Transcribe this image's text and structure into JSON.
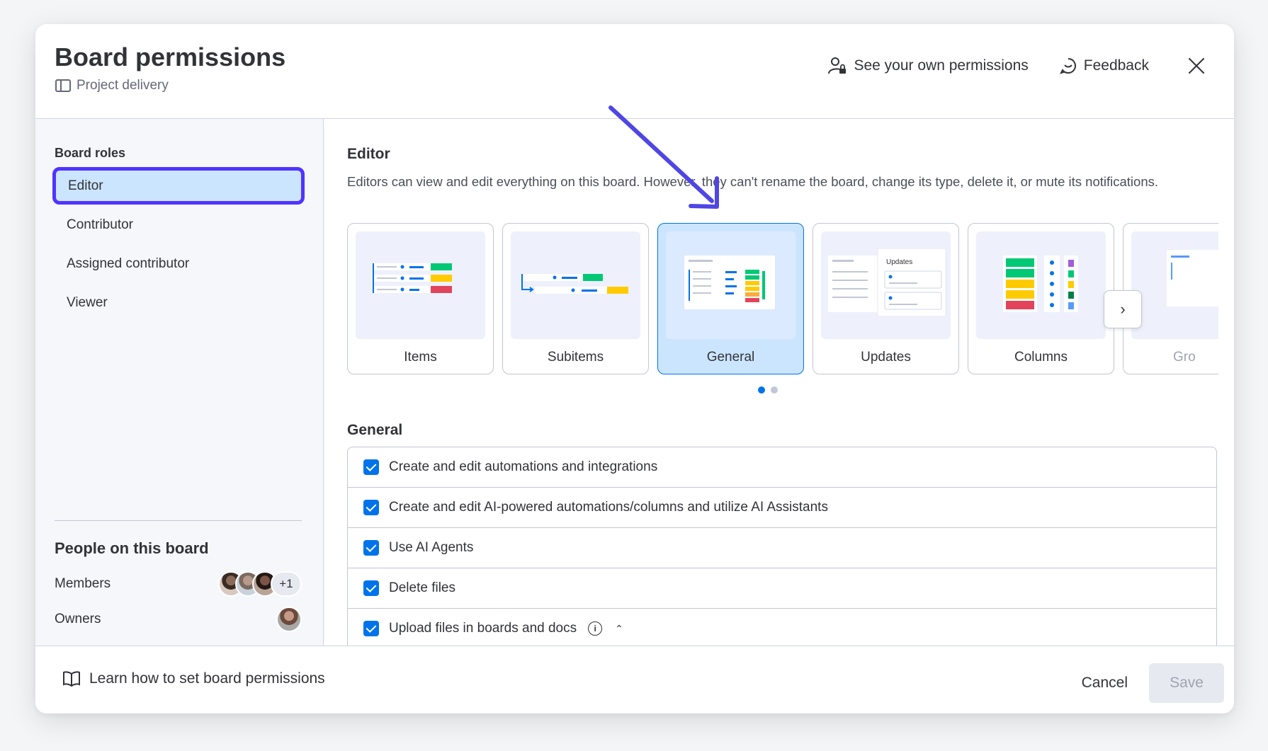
{
  "header": {
    "title": "Board permissions",
    "board_name": "Project delivery",
    "see_permissions_label": "See your own permissions",
    "feedback_label": "Feedback"
  },
  "sidebar": {
    "heading": "Board roles",
    "roles": [
      {
        "label": "Editor",
        "active": true
      },
      {
        "label": "Contributor"
      },
      {
        "label": "Assigned contributor"
      },
      {
        "label": "Viewer"
      }
    ],
    "people_heading": "People on this board",
    "members_label": "Members",
    "members_extra": "+1",
    "owners_label": "Owners"
  },
  "main": {
    "role_title": "Editor",
    "role_description": "Editors can view and edit everything on this board. However, they can't rename the board, change its type, delete it, or mute its notifications.",
    "cards": [
      "Items",
      "Subitems",
      "General",
      "Updates",
      "Columns",
      "Gro"
    ],
    "selected_card": "General",
    "section_title": "General",
    "permissions": [
      "Create and edit automations and integrations",
      "Create and edit AI-powered automations/columns and utilize AI Assistants",
      "Use AI Agents",
      "Delete files",
      "Upload files in boards and docs"
    ]
  },
  "footer": {
    "learn_label": "Learn how to set board permissions",
    "cancel_label": "Cancel",
    "save_label": "Save"
  },
  "colors": {
    "accent": "#0073ea",
    "highlight": "#5034ff",
    "selected_bg": "#cce5ff"
  }
}
